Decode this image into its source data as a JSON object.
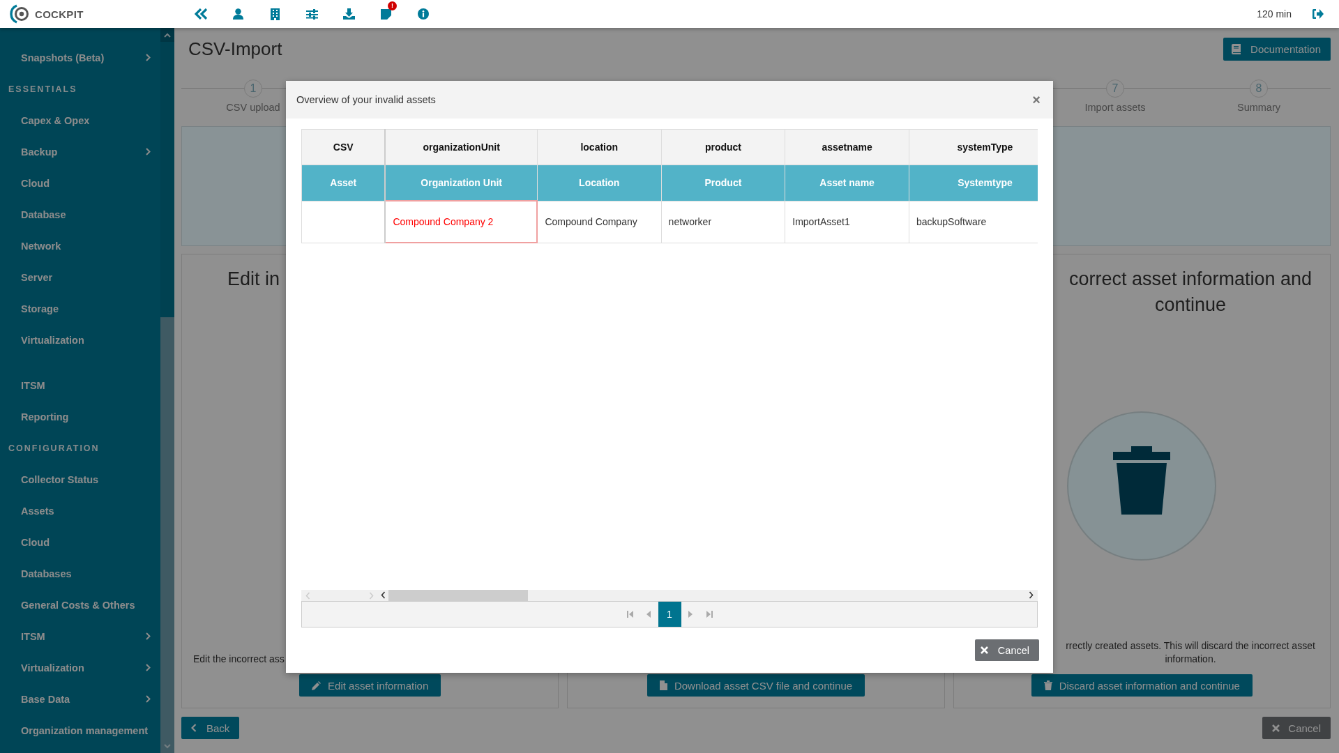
{
  "app": {
    "name": "COCKPIT",
    "session": "120 min",
    "toolbar": [
      {
        "kind": "collapse"
      },
      {
        "kind": "user"
      },
      {
        "kind": "building"
      },
      {
        "kind": "sliders"
      },
      {
        "kind": "download"
      },
      {
        "kind": "notes",
        "badge": "!"
      },
      {
        "kind": "info"
      }
    ]
  },
  "sidebar": {
    "items": [
      {
        "kind": "link",
        "label": "Snapshots (Beta)",
        "submenu": true
      },
      {
        "kind": "section",
        "label": "ESSENTIALS"
      },
      {
        "kind": "link",
        "label": "Capex & Opex",
        "submenu": false
      },
      {
        "kind": "link",
        "label": "Backup",
        "submenu": true
      },
      {
        "kind": "link",
        "label": "Cloud",
        "submenu": false
      },
      {
        "kind": "link",
        "label": "Database",
        "submenu": false
      },
      {
        "kind": "link",
        "label": "Network",
        "submenu": false
      },
      {
        "kind": "link",
        "label": "Server",
        "submenu": false
      },
      {
        "kind": "link",
        "label": "Storage",
        "submenu": false
      },
      {
        "kind": "link",
        "label": "Virtualization",
        "submenu": false
      },
      {
        "kind": "spacer"
      },
      {
        "kind": "link",
        "label": "ITSM",
        "submenu": false
      },
      {
        "kind": "link",
        "label": "Reporting",
        "submenu": false
      },
      {
        "kind": "section",
        "label": "CONFIGURATION"
      },
      {
        "kind": "link",
        "label": "Collector Status",
        "submenu": false
      },
      {
        "kind": "link",
        "label": "Assets",
        "submenu": false
      },
      {
        "kind": "link",
        "label": "Cloud",
        "submenu": false
      },
      {
        "kind": "link",
        "label": "Databases",
        "submenu": false
      },
      {
        "kind": "link",
        "label": "General Costs & Others",
        "submenu": false
      },
      {
        "kind": "link",
        "label": "ITSM",
        "submenu": true
      },
      {
        "kind": "link",
        "label": "Virtualization",
        "submenu": true
      },
      {
        "kind": "link",
        "label": "Base Data",
        "submenu": true
      },
      {
        "kind": "link",
        "label": "Organization management",
        "submenu": false
      }
    ]
  },
  "page": {
    "title": "CSV-Import",
    "documentation_button": "Documentation",
    "steps": [
      {
        "number": "1",
        "label": "CSV upload"
      },
      {
        "number": "7",
        "label": "Import assets"
      },
      {
        "number": "8",
        "label": "Summary"
      }
    ],
    "options": [
      {
        "kind": "edit",
        "title": "Edit in",
        "description": "Edit the incorrect ass",
        "button": "Edit asset information"
      },
      {
        "kind": "download",
        "button": "Download asset CSV file and continue"
      },
      {
        "kind": "discard",
        "title": "correct asset information and continue",
        "description": "rrectly created assets. This will discard the incorrect asset information.",
        "button": "Discard asset information and continue"
      }
    ],
    "back_button": "Back",
    "cancel_button": "Cancel"
  },
  "modal": {
    "title": "Overview of your invalid assets",
    "close": "×",
    "table": {
      "columns": [
        {
          "field": "CSV",
          "label": "Asset"
        },
        {
          "field": "organizationUnit",
          "label": "Organization Unit"
        },
        {
          "field": "location",
          "label": "Location"
        },
        {
          "field": "product",
          "label": "Product"
        },
        {
          "field": "assetname",
          "label": "Asset name"
        },
        {
          "field": "systemType",
          "label": "Systemtype"
        }
      ],
      "rows": [
        {
          "cells": [
            {
              "invalid": false
            },
            {
              "text": "Compound Company 2",
              "invalid": true
            },
            {
              "text": "Compound Company",
              "invalid": false
            },
            {
              "text": "networker",
              "invalid": false
            },
            {
              "text": "ImportAsset1",
              "invalid": false
            },
            {
              "text": "backupSoftware",
              "invalid": false
            }
          ]
        }
      ]
    },
    "pager": {
      "pages": [
        {
          "label": "1",
          "selected": true
        }
      ]
    },
    "cancel_button": "Cancel"
  }
}
